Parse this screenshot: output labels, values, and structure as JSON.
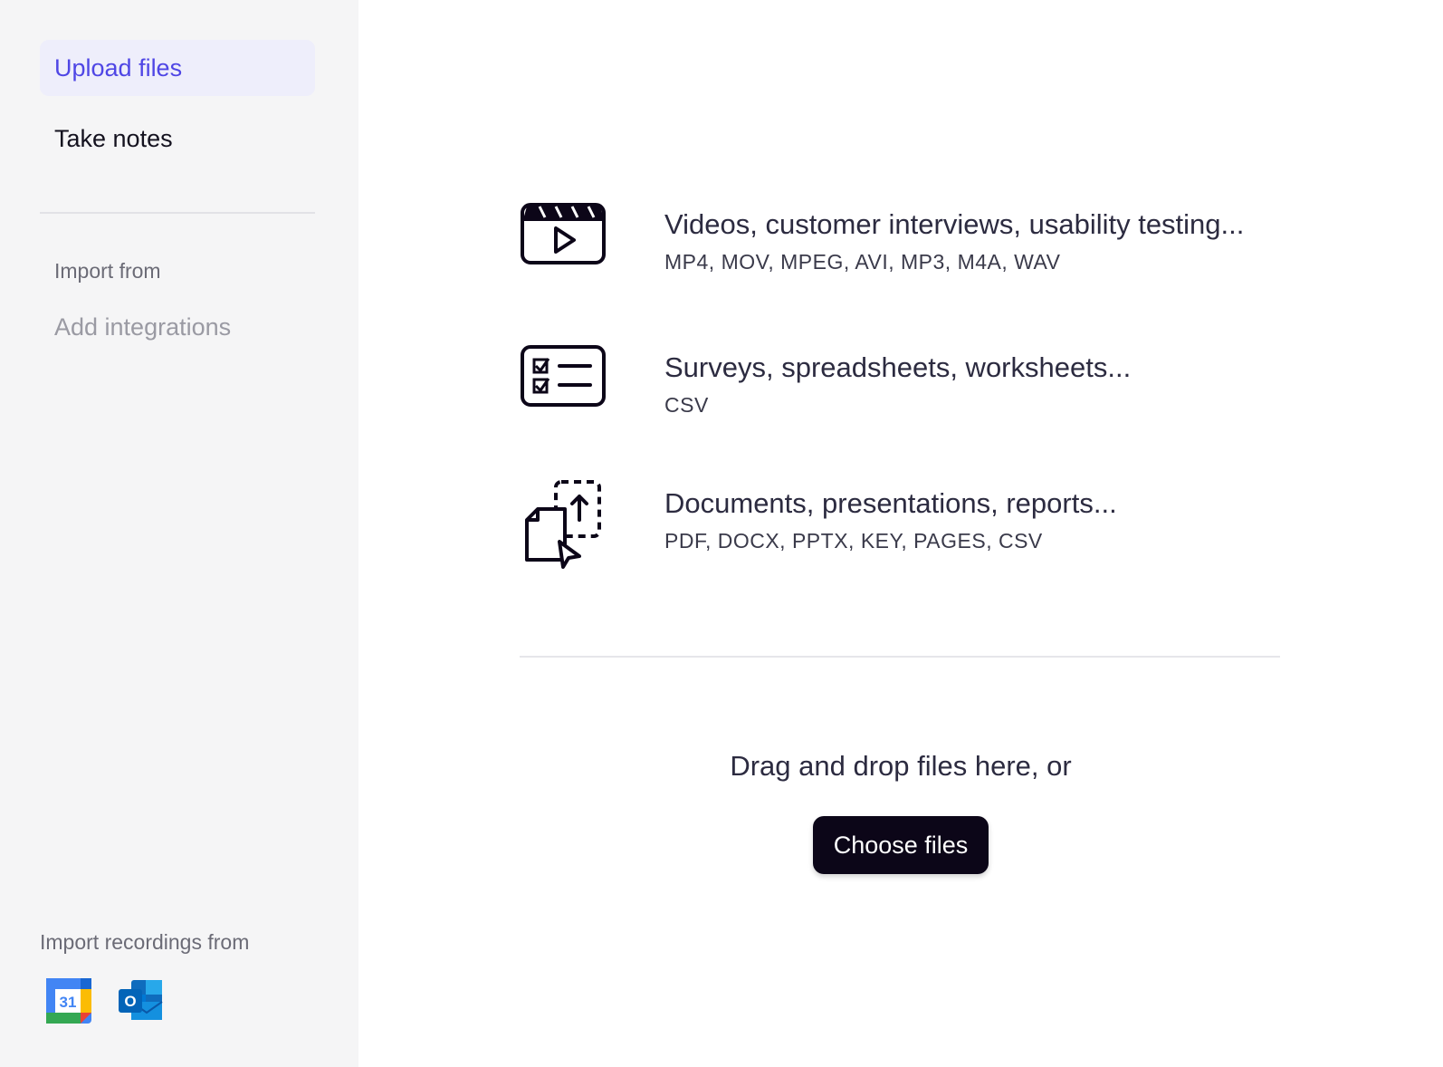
{
  "sidebar": {
    "nav": [
      {
        "label": "Upload files",
        "active": true
      },
      {
        "label": "Take notes",
        "active": false
      }
    ],
    "import_label": "Import from",
    "add_integrations": "Add integrations",
    "recordings_label": "Import recordings from",
    "apps": [
      {
        "name": "google-calendar-icon",
        "text": "31"
      },
      {
        "name": "outlook-icon",
        "text": "O"
      }
    ]
  },
  "main": {
    "categories": [
      {
        "icon": "video-clapper-icon",
        "title": "Videos, customer interviews, usability testing...",
        "formats": "MP4, MOV, MPEG, AVI, MP3, M4A, WAV"
      },
      {
        "icon": "checklist-icon",
        "title": "Surveys, spreadsheets, worksheets...",
        "formats": "CSV"
      },
      {
        "icon": "document-upload-icon",
        "title": "Documents, presentations, reports...",
        "formats": "PDF, DOCX, PPTX, KEY, PAGES, CSV"
      }
    ],
    "drop_text": "Drag and drop files here, or",
    "choose_button": "Choose files"
  },
  "colors": {
    "accent": "#4f46e5",
    "active_bg": "#eeeefb",
    "sidebar_bg": "#f5f5f6",
    "button_bg": "#0c0618"
  }
}
